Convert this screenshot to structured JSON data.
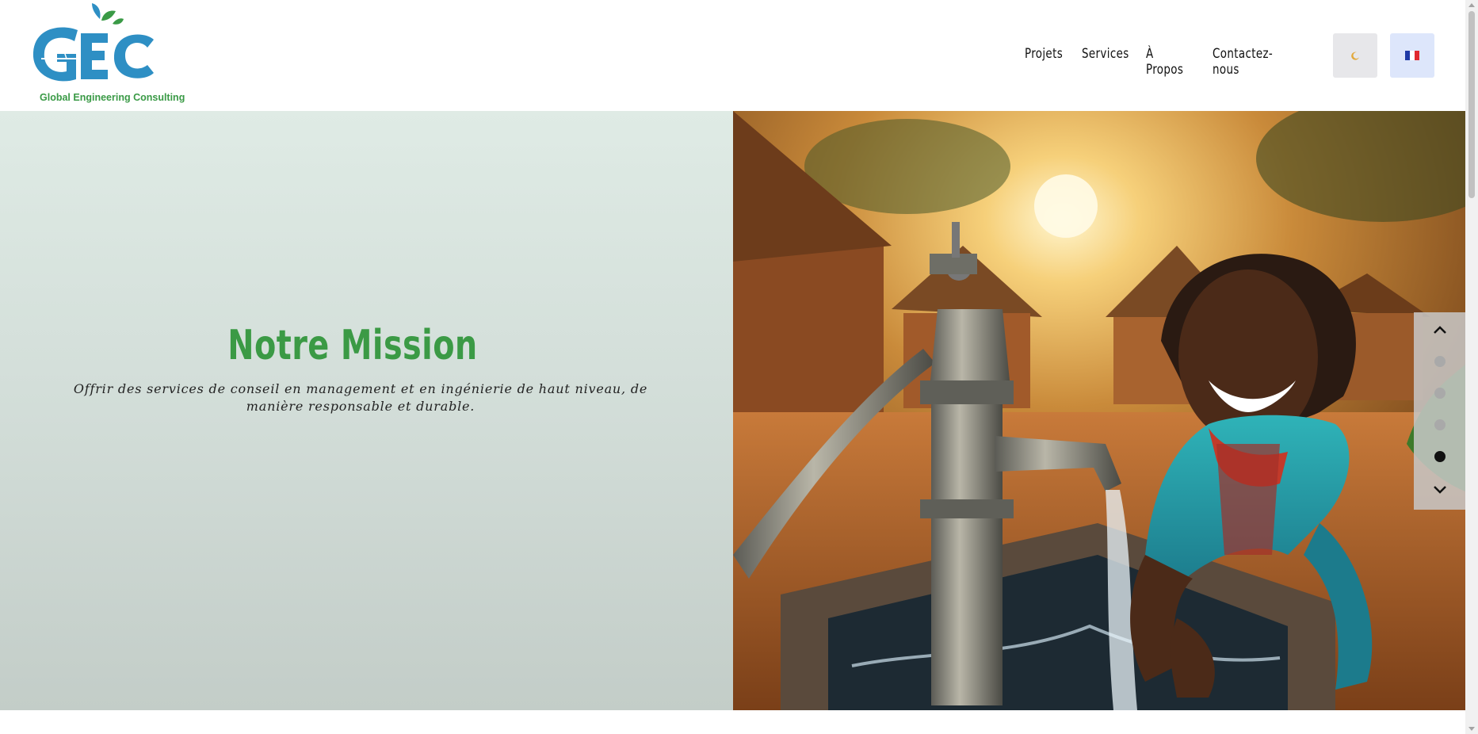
{
  "header": {
    "logo_text": "Global Engineering Consulting",
    "nav": [
      "Projets",
      "Services",
      "À Propos",
      "Contactez-nous"
    ],
    "theme_toggle_icon": "moon-icon",
    "language_icon": "france-flag-icon"
  },
  "hero": {
    "title": "Notre Mission",
    "text": "Offrir des services de conseil en management et en ingénierie de haut niveau, de manière responsable et durable.",
    "image": "girl-at-water-pump-photo"
  },
  "slider": {
    "slides_count": 4,
    "active_index": 3,
    "up_icon": "chevron-up-icon",
    "down_icon": "chevron-down-icon"
  },
  "colors": {
    "accent_green": "#3b9a45",
    "logo_blue": "#2e8fc4",
    "panel_bg": "#d6e2dc"
  }
}
